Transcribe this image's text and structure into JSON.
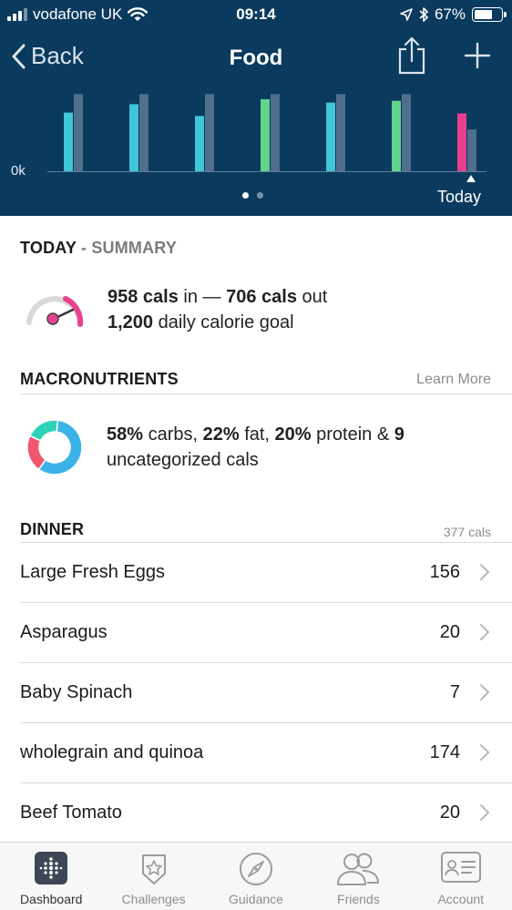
{
  "status": {
    "carrier": "vodafone UK",
    "time": "09:14",
    "battery": "67%",
    "battery_level": 0.67
  },
  "nav": {
    "back_label": "Back",
    "title": "Food",
    "share_icon": "share-icon",
    "add_icon": "plus-icon"
  },
  "chart": {
    "zero_label": "0k",
    "today_label": "Today",
    "pages": 2,
    "active_page": 0
  },
  "chart_data": {
    "type": "bar",
    "categories": [
      "",
      "",
      "",
      "",
      "",
      "",
      "Today"
    ],
    "series": [
      {
        "values": [
          70,
          80,
          66,
          86,
          82,
          84,
          69
        ]
      },
      {
        "values": [
          92,
          92,
          92,
          92,
          92,
          92,
          50
        ]
      }
    ],
    "in_colors": [
      "#3fc6d8",
      "#3fc6d8",
      "#3fc6d8",
      "#62d48c",
      "#3fc6d8",
      "#62d48c",
      "#ea3f8e"
    ],
    "goal_color": "#4f6f8c",
    "ylim": [
      0,
      100
    ],
    "ylabel": "",
    "xlabel": ""
  },
  "summary": {
    "head_bold": "TODAY",
    "head_sep": " - ",
    "head_muted": "SUMMARY",
    "cals_in_value": "958 cals",
    "cals_in_word": " in — ",
    "cals_out_value": "706 cals",
    "cals_out_word": " out",
    "goal_value": "1,200",
    "goal_text": " daily calorie goal",
    "gauge_level": 0.8
  },
  "macros": {
    "head": "MACRONUTRIENTS",
    "learn_more": "Learn More",
    "carbs_pct": "58%",
    "carbs_word": " carbs, ",
    "fat_pct": "22%",
    "fat_word": " fat, ",
    "protein_pct": "20%",
    "protein_word": " protein & ",
    "uncat_value": "9",
    "uncat_word": " uncategorized cals",
    "donut": [
      {
        "name": "carbs",
        "value": 58,
        "color": "#3ab3e8"
      },
      {
        "name": "fat",
        "value": 22,
        "color": "#f0566e"
      },
      {
        "name": "protein",
        "value": 20,
        "color": "#2ed3b7"
      }
    ]
  },
  "dinner": {
    "head": "DINNER",
    "total": "377 cals",
    "items": [
      {
        "name": "Large Fresh Eggs",
        "cals": "156"
      },
      {
        "name": "Asparagus",
        "cals": "20"
      },
      {
        "name": "Baby Spinach",
        "cals": "7"
      },
      {
        "name": "wholegrain and quinoa",
        "cals": "174"
      },
      {
        "name": "Beef Tomato",
        "cals": "20"
      }
    ]
  },
  "tabs": [
    {
      "label": "Dashboard",
      "icon": "dashboard-icon",
      "active": true
    },
    {
      "label": "Challenges",
      "icon": "challenges-star-icon",
      "active": false
    },
    {
      "label": "Guidance",
      "icon": "compass-icon",
      "active": false
    },
    {
      "label": "Friends",
      "icon": "friends-icon",
      "active": false
    },
    {
      "label": "Account",
      "icon": "account-card-icon",
      "active": false
    }
  ]
}
